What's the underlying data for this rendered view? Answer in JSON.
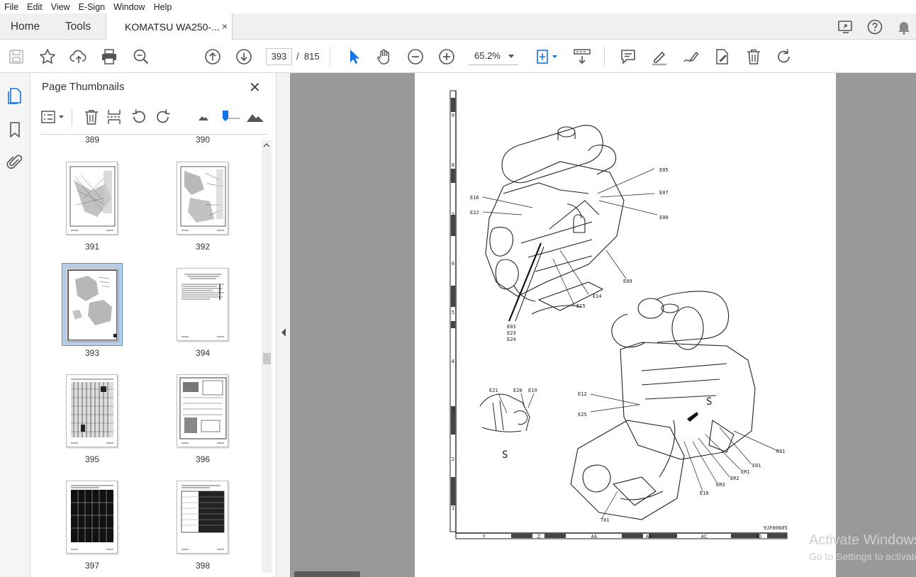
{
  "menu": [
    "File",
    "Edit",
    "View",
    "E-Sign",
    "Window",
    "Help"
  ],
  "tabs": {
    "home": "Home",
    "tools": "Tools",
    "document": "KOMATSU WA250-...",
    "close_glyph": "×"
  },
  "toolbar": {
    "current_page": "393",
    "page_separator": "/",
    "total_pages": "815",
    "zoom": "65.2%"
  },
  "panel": {
    "title": "Page Thumbnails",
    "close_glyph": "✕",
    "partial_labels": [
      "389",
      "390"
    ],
    "thumbnails": [
      {
        "page": "391",
        "kind": "drawing",
        "selected": false
      },
      {
        "page": "392",
        "kind": "drawing",
        "selected": false
      },
      {
        "page": "393",
        "kind": "drawing",
        "selected": true
      },
      {
        "page": "394",
        "kind": "text",
        "selected": false
      },
      {
        "page": "395",
        "kind": "chart",
        "selected": false
      },
      {
        "page": "396",
        "kind": "schematic",
        "selected": false
      },
      {
        "page": "397",
        "kind": "table-dark",
        "selected": false
      },
      {
        "page": "398",
        "kind": "table",
        "selected": false
      }
    ]
  },
  "document": {
    "callouts_top": [
      "E05",
      "E07",
      "E08",
      "E16",
      "E22",
      "E09",
      "E14",
      "E15",
      "E03",
      "E23",
      "E24"
    ],
    "callouts_bottom": [
      "E12",
      "E25",
      "R01",
      "E01",
      "ER1",
      "ER2",
      "ER3",
      "E10",
      "T01"
    ],
    "callouts_inset": [
      "E21",
      "E20",
      "E19"
    ],
    "view_label_1": "S",
    "view_label_2": "S",
    "figure_id": "9JF00605",
    "grid_rows": [
      "9",
      "8",
      "7",
      "6",
      "5",
      "4",
      "3",
      "2",
      "1"
    ],
    "grid_cols": [
      "Y",
      "Z",
      "AA",
      "AB",
      "AC",
      "AD"
    ]
  },
  "watermark": {
    "line1": "Activate Windows",
    "line2": "Go to Settings to activate Windows."
  },
  "colors": {
    "accent_blue": "#1473e6",
    "viewer_bg": "#999999",
    "selected_thumb": "#b7cfe6"
  }
}
